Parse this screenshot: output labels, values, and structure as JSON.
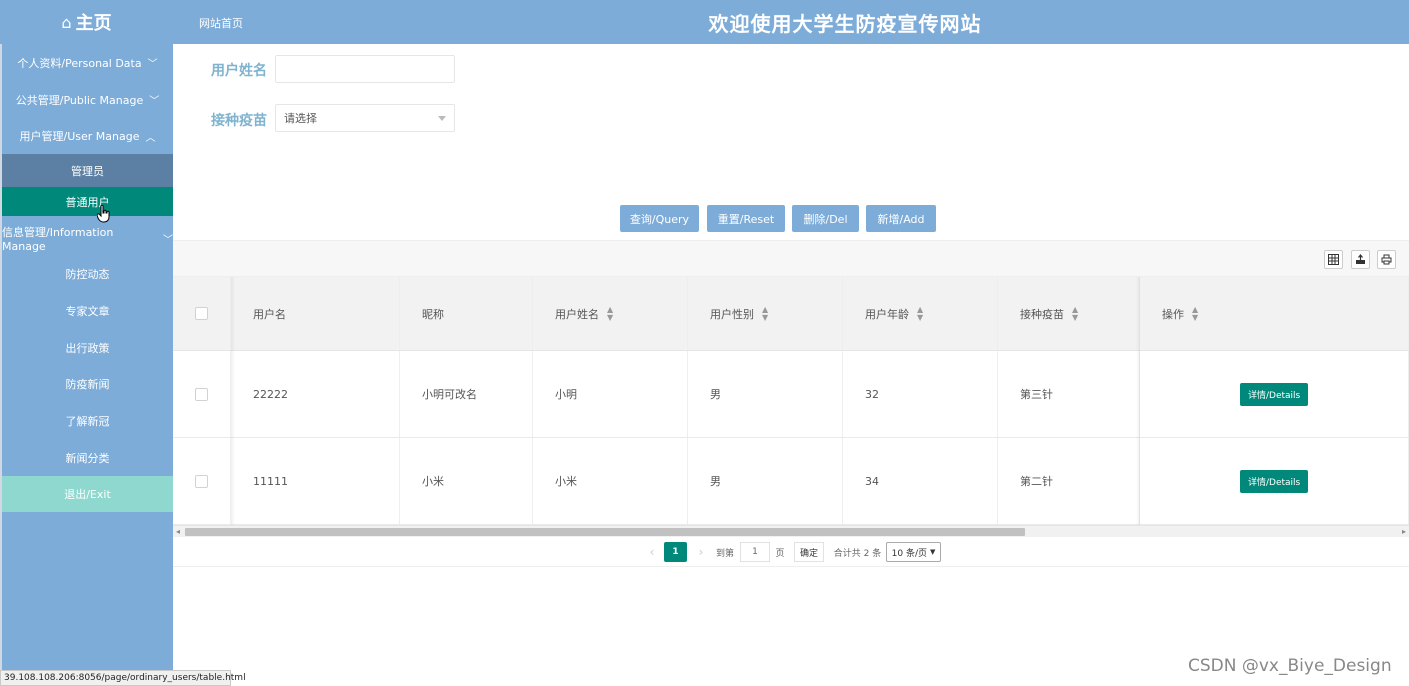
{
  "header": {
    "brand_icon": "home-icon",
    "brand_label": "主页",
    "site_home": "网站首页",
    "title": "欢迎使用大学生防疫宣传网站"
  },
  "sidebar": {
    "personal": "个人资料/Personal Data",
    "public": "公共管理/Public Manage",
    "user": "用户管理/User Manage",
    "user_admin": "管理员",
    "user_ordinary": "普通用户",
    "information": "信息管理/Information Manage",
    "info_items": [
      "防控动态",
      "专家文章",
      "出行政策",
      "防疫新闻",
      "了解新冠",
      "新闻分类"
    ],
    "exit": "退出/Exit"
  },
  "search": {
    "name_label": "用户姓名",
    "name_value": "",
    "vaccine_label": "接种疫苗",
    "vaccine_placeholder": "请选择"
  },
  "buttons": {
    "query": "查询/Query",
    "reset": "重置/Reset",
    "delete": "删除/Del",
    "add": "新增/Add"
  },
  "table": {
    "columns": [
      "用户名",
      "昵称",
      "用户姓名",
      "用户性别",
      "用户年龄",
      "接种疫苗",
      "操作"
    ],
    "rows": [
      {
        "username": "22222",
        "nickname": "小明可改名",
        "name": "小明",
        "gender": "男",
        "age": "32",
        "vaccine": "第三针",
        "action": "详情/Details"
      },
      {
        "username": "11111",
        "nickname": "小米",
        "name": "小米",
        "gender": "男",
        "age": "34",
        "vaccine": "第二针",
        "action": "详情/Details"
      }
    ]
  },
  "pagination": {
    "current": "1",
    "goto_label": "到第",
    "goto_value": "1",
    "page_unit": "页",
    "confirm": "确定",
    "total": "合计共 2 条",
    "page_size": "10 条/页"
  },
  "status_url": "39.108.108.206:8056/page/ordinary_users/table.html",
  "watermark": "CSDN @vx_Biye_Design",
  "colors": {
    "primary": "#7dacd9",
    "accent": "#00897b",
    "label": "#7fb3cf",
    "exit": "#8fd8cf"
  }
}
